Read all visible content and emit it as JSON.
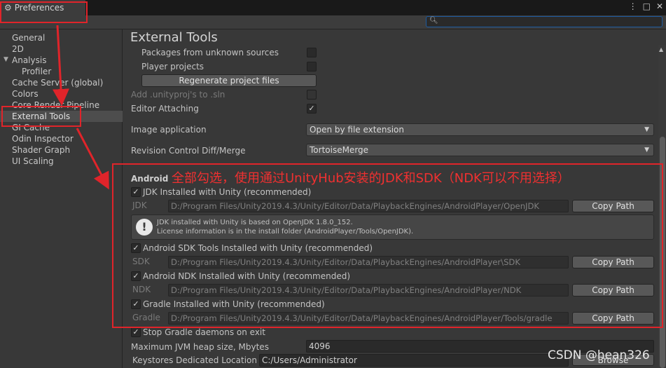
{
  "window": {
    "tab_title": "Preferences",
    "controls": [
      "⋮",
      "□",
      "✕"
    ]
  },
  "search": {
    "value": "",
    "icon": "search-icon"
  },
  "sidebar": {
    "items": [
      {
        "label": "General"
      },
      {
        "label": "2D"
      },
      {
        "label": "Analysis",
        "expanded": true
      },
      {
        "label": "Profiler",
        "sub": true
      },
      {
        "label": "Cache Server (global)"
      },
      {
        "label": "Colors"
      },
      {
        "label": "Core Render Pipeline"
      },
      {
        "label": "External Tools",
        "selected": true
      },
      {
        "label": "GI Cache"
      },
      {
        "label": "Odin Inspector"
      },
      {
        "label": "Shader Graph"
      },
      {
        "label": "UI Scaling"
      }
    ]
  },
  "main": {
    "title": "External Tools",
    "packages_unknown": "Packages from unknown sources",
    "player_projects": "Player projects",
    "regenerate": "Regenerate project files",
    "add_unityproj": "Add .unityproj's to .sln",
    "editor_attaching": "Editor Attaching",
    "image_application": {
      "label": "Image application",
      "value": "Open by file extension"
    },
    "revision_control": {
      "label": "Revision Control Diff/Merge",
      "value": "TortoiseMerge"
    },
    "android": {
      "heading": "Android",
      "jdk": {
        "checkbox": "JDK Installed with Unity (recommended)",
        "short": "JDK",
        "path": "D:/Program Files/Unity2019.4.3/Unity/Editor/Data/PlaybackEngines/AndroidPlayer/OpenJDK",
        "button": "Copy Path",
        "checked": true
      },
      "info": {
        "line1": "JDK installed with Unity is based on OpenJDK 1.8.0_152.",
        "line2": "License information is in the install folder (AndroidPlayer/Tools/OpenJDK)."
      },
      "sdk": {
        "checkbox": "Android SDK Tools Installed with Unity (recommended)",
        "short": "SDK",
        "path": "D:/Program Files/Unity2019.4.3/Unity/Editor/Data/PlaybackEngines/AndroidPlayer\\SDK",
        "button": "Copy Path",
        "checked": true
      },
      "ndk": {
        "checkbox": "Android NDK Installed with Unity (recommended)",
        "short": "NDK",
        "path": "D:/Program Files/Unity2019.4.3/Unity/Editor/Data/PlaybackEngines/AndroidPlayer/NDK",
        "button": "Copy Path",
        "checked": true
      },
      "gradle": {
        "checkbox": "Gradle Installed with Unity (recommended)",
        "short": "Gradle",
        "path": "D:/Program Files/Unity2019.4.3/Unity/Editor/Data/PlaybackEngines/AndroidPlayer/Tools/gradle",
        "button": "Copy Path",
        "checked": true
      },
      "stop_gradle": "Stop Gradle daemons on exit",
      "jvm_heap": {
        "label": "Maximum JVM heap size, Mbytes",
        "value": "4096"
      },
      "keystores": {
        "label": "Keystores Dedicated Location",
        "value": "C:/Users/Administrator",
        "button": "Browse"
      }
    }
  },
  "annotation": {
    "text": "全部勾选，使用通过UnityHub安装的JDK和SDK（NDK可以不用选择）",
    "color": "#e0242a"
  },
  "watermark": "CSDN @hean326"
}
